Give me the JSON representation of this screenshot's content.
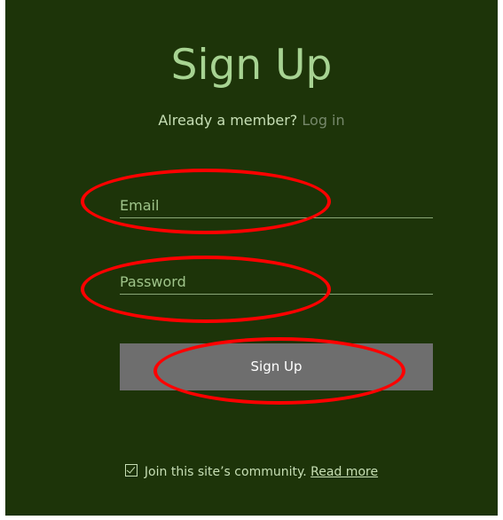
{
  "form": {
    "title": "Sign Up",
    "member_prompt": "Already a member?",
    "login_link": "Log in",
    "email_placeholder": "Email",
    "password_placeholder": "Password",
    "submit_label": "Sign Up",
    "community_label": "Join this site’s community.",
    "read_more_link": "Read more",
    "community_checked": true
  },
  "colors": {
    "background": "#1d3409",
    "title": "#a7d392",
    "button": "#6e6e6e",
    "annotation": "#ff0000"
  }
}
